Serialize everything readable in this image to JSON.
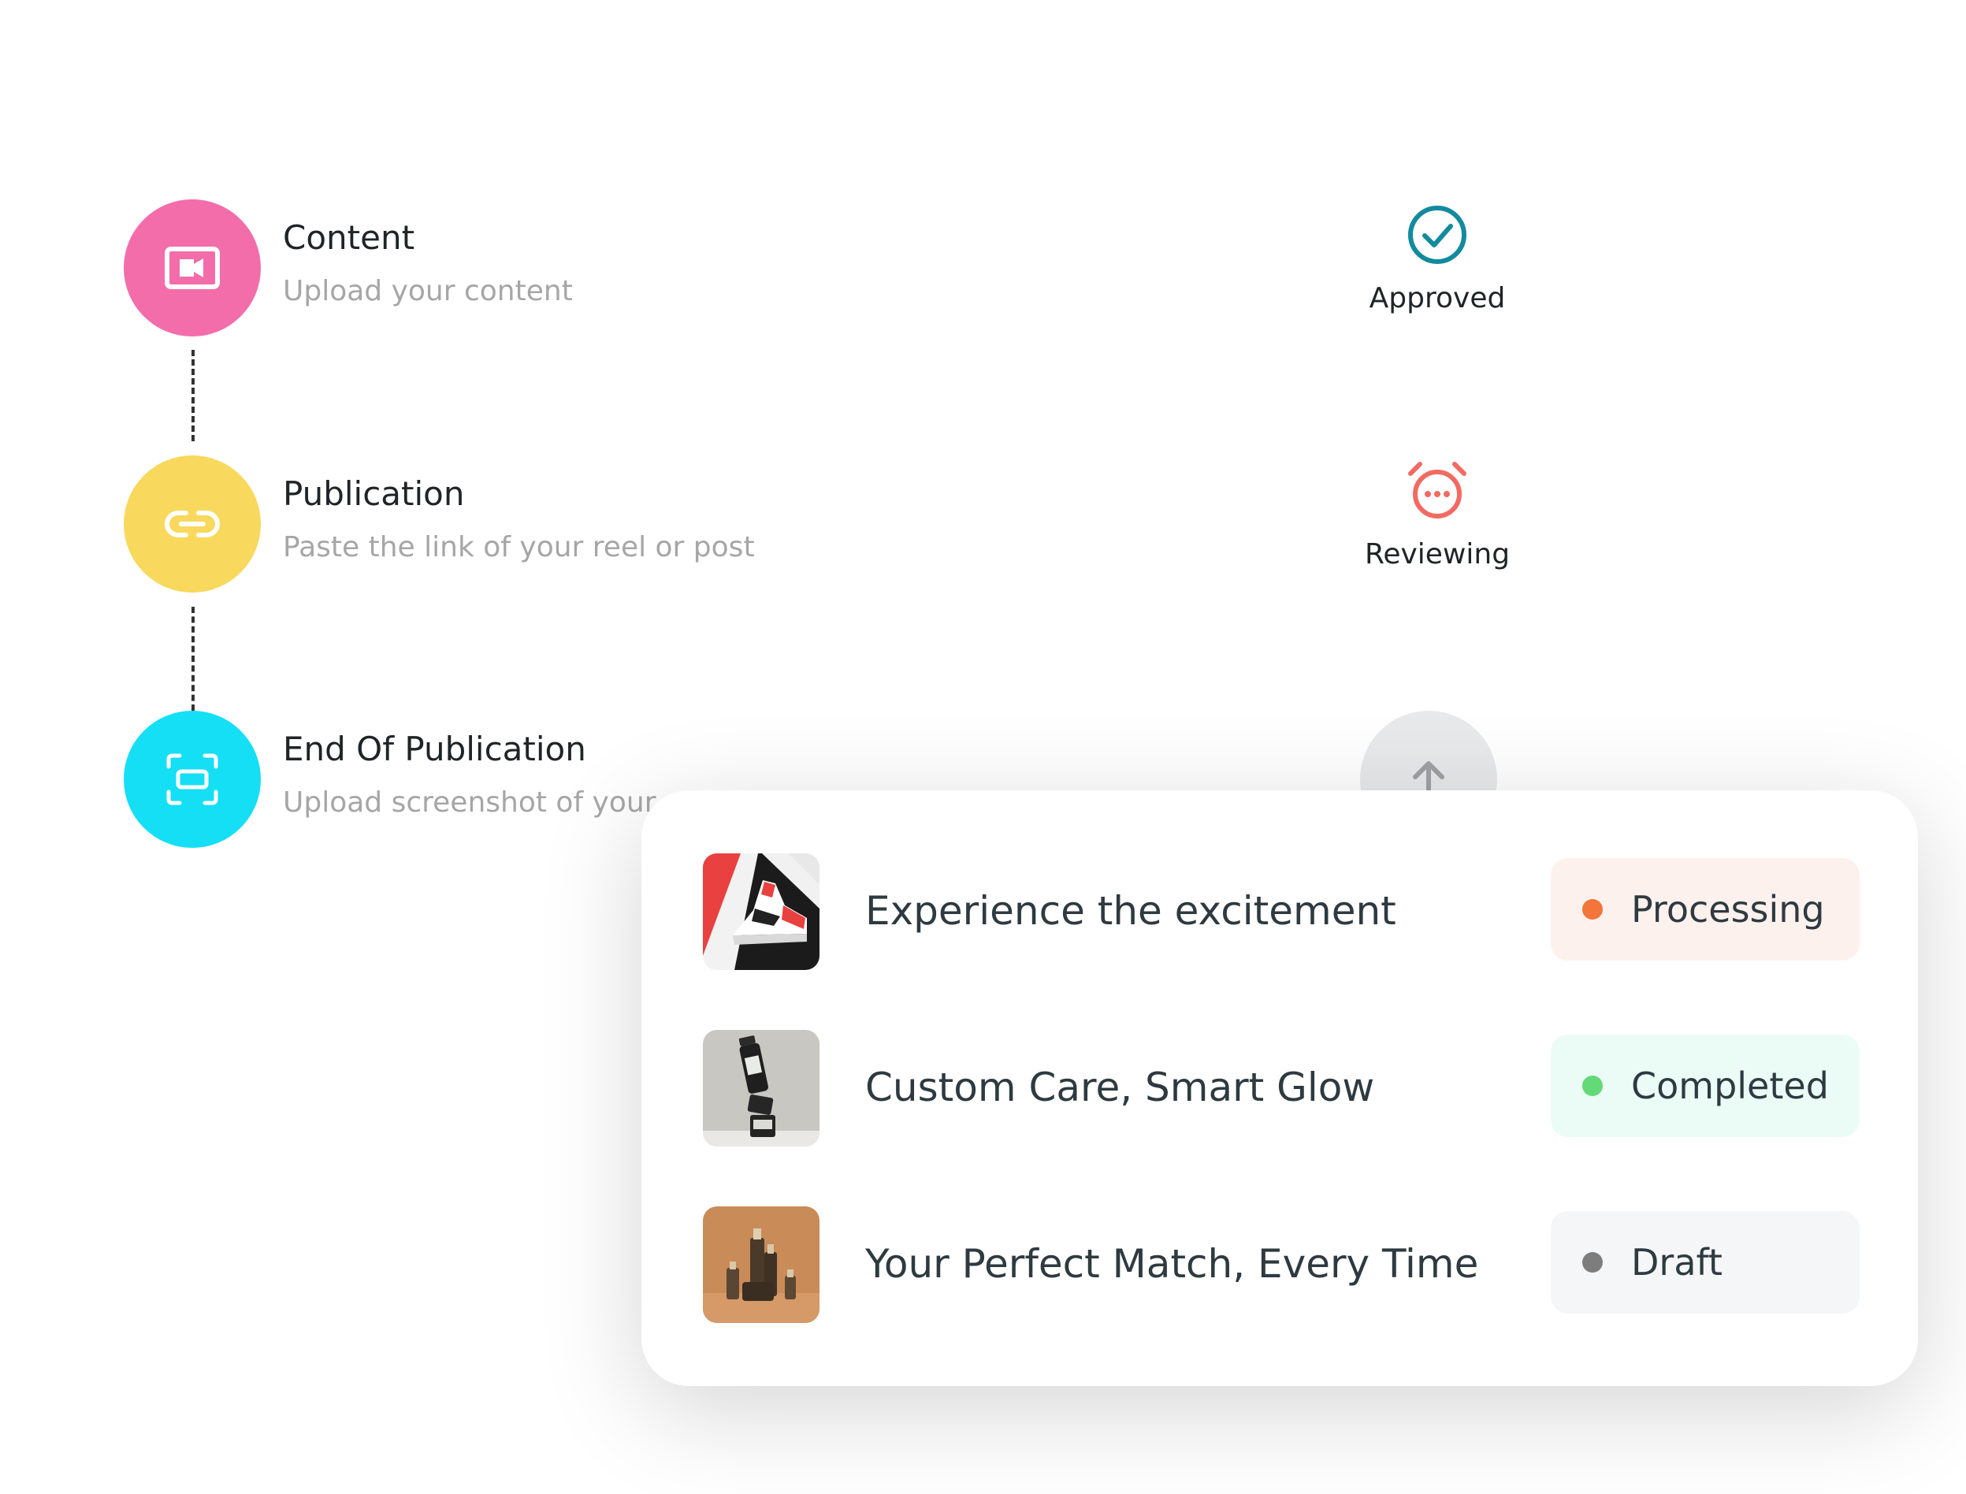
{
  "steps": [
    {
      "title": "Content",
      "subtitle": "Upload your content",
      "color": "#f26daa",
      "icon": "video-icon"
    },
    {
      "title": "Publication",
      "subtitle": "Paste the link of your reel or post",
      "color": "#f8d95d",
      "icon": "link-icon"
    },
    {
      "title": "End Of Publication",
      "subtitle": "Upload screenshot of your",
      "color": "#15dff5",
      "icon": "screenshot-icon"
    }
  ],
  "statuses": [
    {
      "label": "Approved",
      "color": "#138a9e",
      "icon": "check-circle-icon"
    },
    {
      "label": "Reviewing",
      "color": "#f26a62",
      "icon": "alarm-clock-icon"
    }
  ],
  "campaigns": [
    {
      "title": "Experience the excitement",
      "status": "Processing",
      "dot": "#f4753a",
      "bg": "#fdf1ee",
      "thumb": "sneaker-thumbnail"
    },
    {
      "title": "Custom Care, Smart Glow",
      "status": "Completed",
      "dot": "#63d978",
      "bg": "#ebfcf7",
      "thumb": "skincare-bottles-thumbnail"
    },
    {
      "title": "Your Perfect Match, Every Time",
      "status": "Draft",
      "dot": "#7d7d7d",
      "bg": "#f5f6f7",
      "thumb": "serum-bottles-thumbnail"
    }
  ]
}
